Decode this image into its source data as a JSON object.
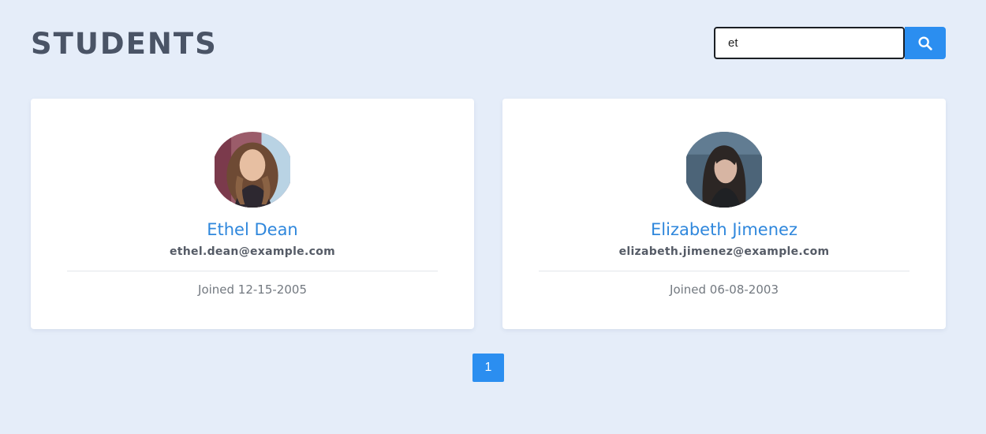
{
  "header": {
    "title": "STUDENTS"
  },
  "search": {
    "value": "et",
    "icon": "search-icon",
    "button_color": "#2b8ef0"
  },
  "students": [
    {
      "name": "Ethel Dean",
      "email": "ethel.dean@example.com",
      "joined": "Joined 12-15-2005",
      "avatar_icon": "avatar-photo"
    },
    {
      "name": "Elizabeth Jimenez",
      "email": "elizabeth.jimenez@example.com",
      "joined": "Joined 06-08-2003",
      "avatar_icon": "avatar-photo"
    }
  ],
  "pagination": {
    "pages": [
      "1"
    ],
    "current": "1"
  },
  "colors": {
    "background": "#e5edf9",
    "accent": "#2b8ef0",
    "name": "#2f87dc",
    "title": "#4a5466"
  }
}
